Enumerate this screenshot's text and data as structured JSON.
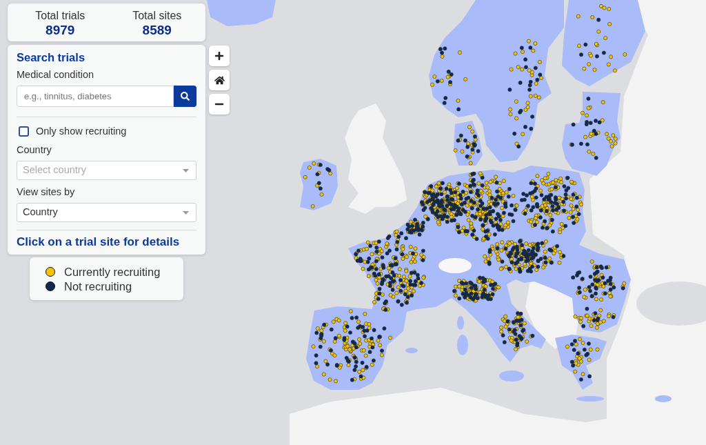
{
  "stats": [
    {
      "label": "Total trials",
      "value": "8979"
    },
    {
      "label": "Total sites",
      "value": "8589"
    }
  ],
  "search_panel": {
    "title": "Search trials",
    "condition_label": "Medical condition",
    "condition_field": {
      "placeholder": "e.g., tinnitus, diabetes"
    },
    "recruiting_filter": {
      "label": "Only show recruiting",
      "checked": false
    },
    "country_label": "Country",
    "country_select": {
      "placeholder": "Select country"
    },
    "view_by_label": "View sites by",
    "view_by_select": {
      "value": "Country"
    },
    "hint": "Click on a trial site for details"
  },
  "map_controls": [
    {
      "kind": "zoom_in"
    },
    {
      "kind": "home"
    },
    {
      "kind": "zoom_out"
    }
  ],
  "legend": {
    "items": [
      {
        "label": "Currently recruiting",
        "color": "#f6c500"
      },
      {
        "label": "Not recruiting",
        "color": "#0e2a52"
      }
    ]
  }
}
